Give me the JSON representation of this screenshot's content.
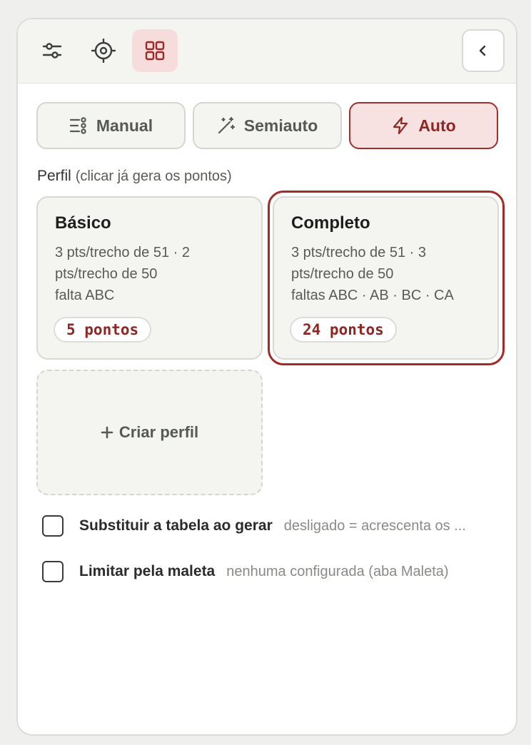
{
  "toolbar": {
    "tools": [
      {
        "icon": "sliders-icon",
        "active": false
      },
      {
        "icon": "crosshair-icon",
        "active": false
      },
      {
        "icon": "grid-icon",
        "active": true
      }
    ],
    "collapse_icon": "chevron-left-icon"
  },
  "modes": [
    {
      "label": "Manual",
      "icon": "list-settings-icon",
      "active": false
    },
    {
      "label": "Semiauto",
      "icon": "magic-wand-icon",
      "active": false
    },
    {
      "label": "Auto",
      "icon": "lightning-icon",
      "active": true
    }
  ],
  "perfil": {
    "label": "Perfil",
    "hint": "(clicar já gera os pontos)",
    "cards": [
      {
        "title": "Básico",
        "lines": [
          "3 pts/trecho de 51 · 2",
          "pts/trecho de 50",
          "falta ABC"
        ],
        "badge": "5 pontos",
        "selected": false
      },
      {
        "title": "Completo",
        "lines": [
          "3 pts/trecho de 51 · 3",
          "pts/trecho de 50",
          "faltas ABC · AB · BC · CA"
        ],
        "badge": "24 pontos",
        "selected": true
      }
    ],
    "create_label": "Criar perfil"
  },
  "options": [
    {
      "label": "Substituir a tabela ao gerar",
      "hint": "desligado = acrescenta os ...",
      "checked": false
    },
    {
      "label": "Limitar pela maleta",
      "hint": "nenhuma configurada (aba Maleta)",
      "checked": false
    }
  ],
  "colors": {
    "accent": "#a32a26",
    "accent_bg": "#f8e1e1",
    "card_bg": "#f4f4f0"
  }
}
